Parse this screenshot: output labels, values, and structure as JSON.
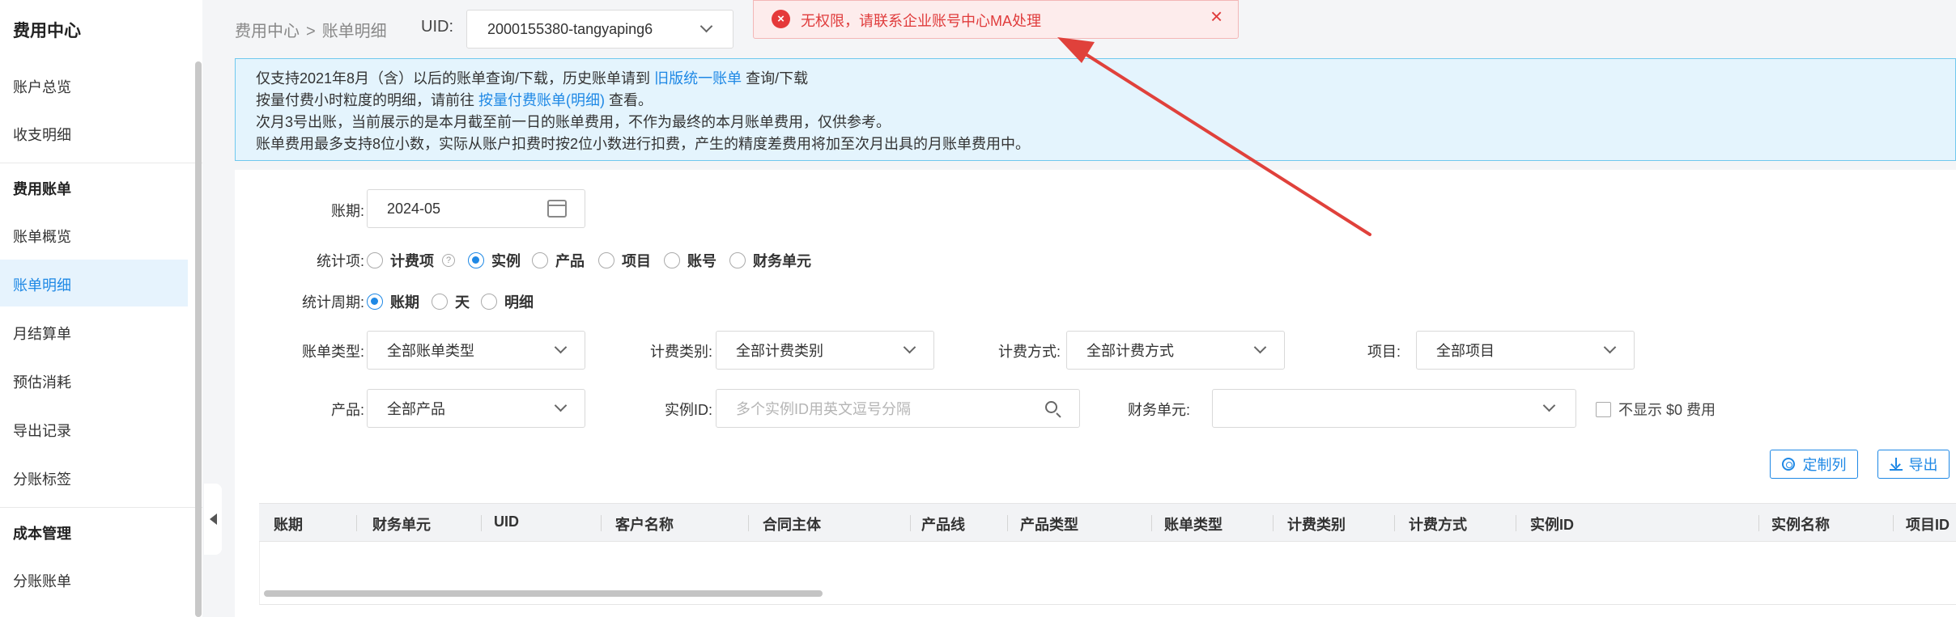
{
  "sidebar": {
    "title": "费用中心",
    "top_items": [
      {
        "label": "账户总览"
      },
      {
        "label": "收支明细"
      }
    ],
    "groups": [
      {
        "label": "费用账单",
        "items": [
          {
            "label": "账单概览"
          },
          {
            "label": "账单明细",
            "active": true
          },
          {
            "label": "月结算单"
          },
          {
            "label": "预估消耗"
          },
          {
            "label": "导出记录"
          },
          {
            "label": "分账标签"
          }
        ]
      },
      {
        "label": "成本管理",
        "items": [
          {
            "label": "分账账单"
          }
        ]
      }
    ]
  },
  "header": {
    "breadcrumb": [
      "费用中心",
      "账单明细"
    ],
    "breadcrumb_separator": ">",
    "uid_label": "UID:",
    "uid_value": "2000155380-tangyaping6"
  },
  "toast": {
    "message": "无权限，请联系企业账号中心MA处理",
    "close": "×",
    "icon": "error-circle-icon",
    "color": "#e5393a"
  },
  "notice": {
    "line1_pre": "仅支持2021年8月（含）以后的账单查询/下载，历史账单请到",
    "line1_link": "旧版统一账单",
    "line1_post": "查询/下载",
    "line2_pre": "按量付费小时粒度的明细，请前往",
    "line2_link": "按量付费账单(明细)",
    "line2_post": "查看。",
    "line3": "次月3号出账，当前展示的是本月截至前一日的账单费用，不作为最终的本月账单费用，仅供参考。",
    "line4": "账单费用最多支持8位小数，实际从账户扣费时按2位小数进行扣费，产生的精度差费用将加至次月出具的月账单费用中。"
  },
  "filters": {
    "period_label": "账期:",
    "period_value": "2024-05",
    "stat_label": "统计项:",
    "stat_options": [
      {
        "label": "计费项",
        "help": "?",
        "selected": false
      },
      {
        "label": "实例",
        "selected": true
      },
      {
        "label": "产品",
        "selected": false
      },
      {
        "label": "项目",
        "selected": false
      },
      {
        "label": "账号",
        "selected": false
      },
      {
        "label": "财务单元",
        "selected": false
      }
    ],
    "cycle_label": "统计周期:",
    "cycle_options": [
      {
        "label": "账期",
        "selected": true
      },
      {
        "label": "天",
        "selected": false
      },
      {
        "label": "明细",
        "selected": false
      }
    ],
    "bill_type_label": "账单类型:",
    "bill_type_value": "全部账单类型",
    "charge_cat_label": "计费类别:",
    "charge_cat_value": "全部计费类别",
    "charge_mode_label": "计费方式:",
    "charge_mode_value": "全部计费方式",
    "project_label": "项目:",
    "project_value": "全部项目",
    "product_label": "产品:",
    "product_value": "全部产品",
    "instance_label": "实例ID:",
    "instance_placeholder": "多个实例ID用英文逗号分隔",
    "finance_label": "财务单元:",
    "finance_value": "",
    "hide_zero_label": "不显示 $0 费用"
  },
  "actions": {
    "customize": "定制列",
    "export": "导出"
  },
  "table": {
    "columns": [
      "账期",
      "财务单元",
      "UID",
      "客户名称",
      "合同主体",
      "产品线",
      "产品类型",
      "账单类型",
      "计费类别",
      "计费方式",
      "实例ID",
      "实例名称",
      "项目ID"
    ]
  },
  "colors": {
    "accent": "#1e88e5",
    "error": "#e5393a",
    "notice_bg": "#e4f4fd",
    "arrow": "#e0413b"
  }
}
